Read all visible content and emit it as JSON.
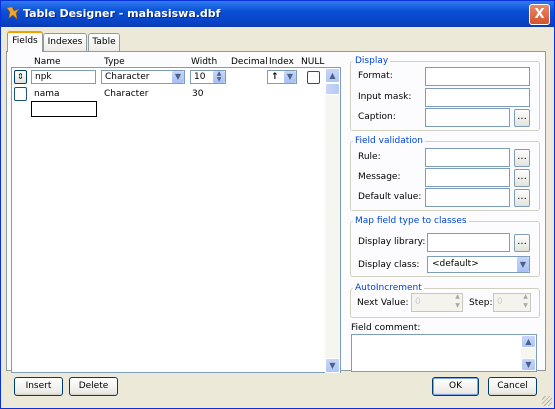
{
  "window": {
    "title": "Table Designer - mahasiswa.dbf",
    "close": "X"
  },
  "tabs": [
    {
      "label": "Fields",
      "active": true
    },
    {
      "label": "Indexes"
    },
    {
      "label": "Table"
    }
  ],
  "grid": {
    "headers": {
      "name": "Name",
      "type": "Type",
      "width": "Width",
      "decimal": "Decimal",
      "index": "Index",
      "null": "NULL"
    },
    "rows": [
      {
        "name": "npk",
        "type": "Character",
        "width": "10",
        "index": "↑"
      },
      {
        "name": "nama",
        "type": "Character",
        "width": "30"
      }
    ]
  },
  "display": {
    "title": "Display",
    "format_label": "Format:",
    "input_mask_label": "Input mask:",
    "caption_label": "Caption:"
  },
  "validation": {
    "title": "Field validation",
    "rule_label": "Rule:",
    "message_label": "Message:",
    "default_label": "Default value:"
  },
  "map": {
    "title": "Map field type to classes",
    "library_label": "Display library:",
    "class_label": "Display class:",
    "class_value": "<default>"
  },
  "autoinc": {
    "title": "AutoIncrement",
    "next_label": "Next Value:",
    "step_label": "Step:",
    "next_value": "0",
    "step_value": "0"
  },
  "comment_label": "Field comment:",
  "buttons": {
    "ellipsis": "...",
    "insert": "Insert",
    "delete": "Delete",
    "ok": "OK",
    "cancel": "Cancel"
  },
  "colors": {
    "titlebar": "#0a4fd6",
    "group_title": "#0046d5",
    "face": "#ece9d8"
  },
  "icons": {
    "app": "fox-icon",
    "up": "arrow-up-icon",
    "down": "arrow-down-icon",
    "move": "updown-icon"
  }
}
